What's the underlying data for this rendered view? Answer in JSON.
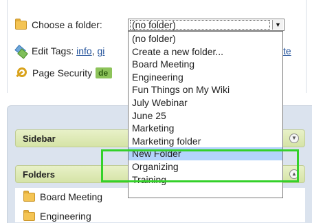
{
  "folder_row": {
    "label": "Choose a folder:",
    "selected_value": "(no folder)"
  },
  "tags_row": {
    "label": "Edit Tags:",
    "tag_link": "info",
    "tag_link_partial": "gi",
    "template_link_partial": "template"
  },
  "security_row": {
    "label": "Page Security",
    "badge": "de"
  },
  "dropdown": {
    "options": [
      "(no folder)",
      "Create a new folder...",
      "Board Meeting",
      "Engineering",
      "Fun Things on My Wiki",
      "July Webinar",
      "June 25",
      "Marketing",
      "Marketing folder",
      "New Folder",
      "Organizing",
      "Training"
    ],
    "highlighted_index": 9
  },
  "sidebar_section": {
    "title": "Sidebar"
  },
  "folders_section": {
    "title": "Folders"
  },
  "folder_list": {
    "items": [
      "Board Meeting",
      "Engineering"
    ]
  },
  "colors": {
    "highlight_box": "#34d12a",
    "selected_option": "#b3d4fc",
    "section_header": "#d5e3a6"
  }
}
